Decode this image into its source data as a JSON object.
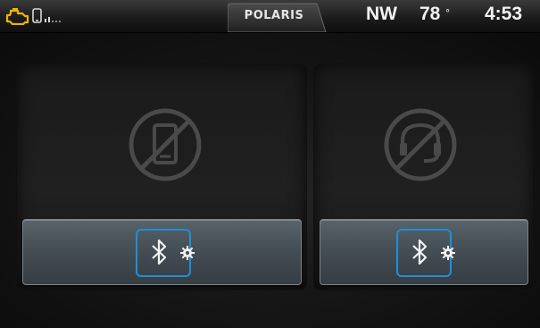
{
  "status_bar": {
    "brand": "POLARIS",
    "heading": "NW",
    "temperature": "78",
    "temperature_unit": "°",
    "clock": "4:53",
    "engine_icon": "check-engine-icon",
    "phone_icon": "phone-signal-icon"
  },
  "panels": [
    {
      "status_icon": "phone-disabled-icon",
      "button_icon": "bluetooth-settings-icon"
    },
    {
      "status_icon": "headset-disabled-icon",
      "button_icon": "bluetooth-settings-icon"
    }
  ],
  "colors": {
    "accent_blue": "#1e8fd6",
    "engine_warning": "#f0b400",
    "text": "#f2f2f2",
    "disabled_icon": "#4a4a4a"
  }
}
